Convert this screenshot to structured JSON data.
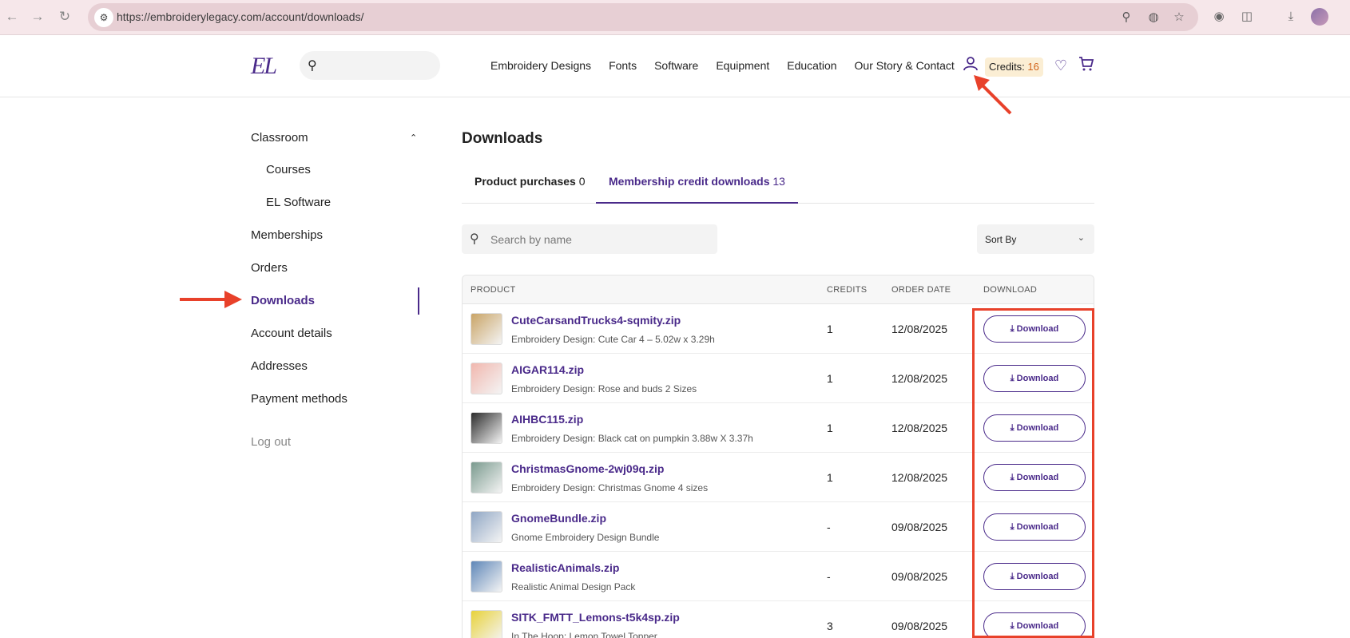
{
  "browser": {
    "url": "https://embroiderylegacy.com/account/downloads/"
  },
  "header": {
    "logo": "EL",
    "nav": [
      "Embroidery Designs",
      "Fonts",
      "Software",
      "Equipment",
      "Education",
      "Our Story & Contact"
    ],
    "credits_label": "Credits:",
    "credits_value": "16"
  },
  "sidebar": {
    "items": [
      {
        "label": "Classroom"
      },
      {
        "label": "Courses"
      },
      {
        "label": "EL Software"
      },
      {
        "label": "Memberships"
      },
      {
        "label": "Orders"
      },
      {
        "label": "Downloads"
      },
      {
        "label": "Account details"
      },
      {
        "label": "Addresses"
      },
      {
        "label": "Payment methods"
      },
      {
        "label": "Log out"
      }
    ]
  },
  "main": {
    "title": "Downloads",
    "tabs": [
      {
        "label": "Product purchases",
        "count": "0"
      },
      {
        "label": "Membership credit downloads",
        "count": "13"
      }
    ],
    "search_placeholder": "Search by name",
    "sort_label": "Sort By",
    "columns": [
      "PRODUCT",
      "CREDITS",
      "ORDER DATE",
      "DOWNLOAD"
    ],
    "download_label": "Download",
    "rows": [
      {
        "name": "CuteCarsandTrucks4-sqmity.zip",
        "desc": "Embroidery Design: Cute Car 4 – 5.02w x 3.29h",
        "credits": "1",
        "date": "12/08/2025",
        "thumb_color": "#c9a466"
      },
      {
        "name": "AIGAR114.zip",
        "desc": "Embroidery Design: Rose and buds 2 Sizes",
        "credits": "1",
        "date": "12/08/2025",
        "thumb_color": "#f1b7ae"
      },
      {
        "name": "AIHBC115.zip",
        "desc": "Embroidery Design: Black cat on pumpkin 3.88w X 3.37h",
        "credits": "1",
        "date": "12/08/2025",
        "thumb_color": "#2b2b2b"
      },
      {
        "name": "ChristmasGnome-2wj09q.zip",
        "desc": "Embroidery Design: Christmas Gnome 4 sizes",
        "credits": "1",
        "date": "12/08/2025",
        "thumb_color": "#7a9a8e"
      },
      {
        "name": "GnomeBundle.zip",
        "desc": "Gnome Embroidery Design Bundle",
        "credits": "-",
        "date": "09/08/2025",
        "thumb_color": "#8fa6c4"
      },
      {
        "name": "RealisticAnimals.zip",
        "desc": "Realistic Animal Design Pack",
        "credits": "-",
        "date": "09/08/2025",
        "thumb_color": "#5f87b8"
      },
      {
        "name": "SITK_FMTT_Lemons-t5k4sp.zip",
        "desc": "In The Hoop: Lemon Towel Topper",
        "credits": "3",
        "date": "09/08/2025",
        "thumb_color": "#e8d23a"
      }
    ]
  },
  "colors": {
    "accent": "#4a2a8a",
    "annotation": "#e8412a"
  }
}
